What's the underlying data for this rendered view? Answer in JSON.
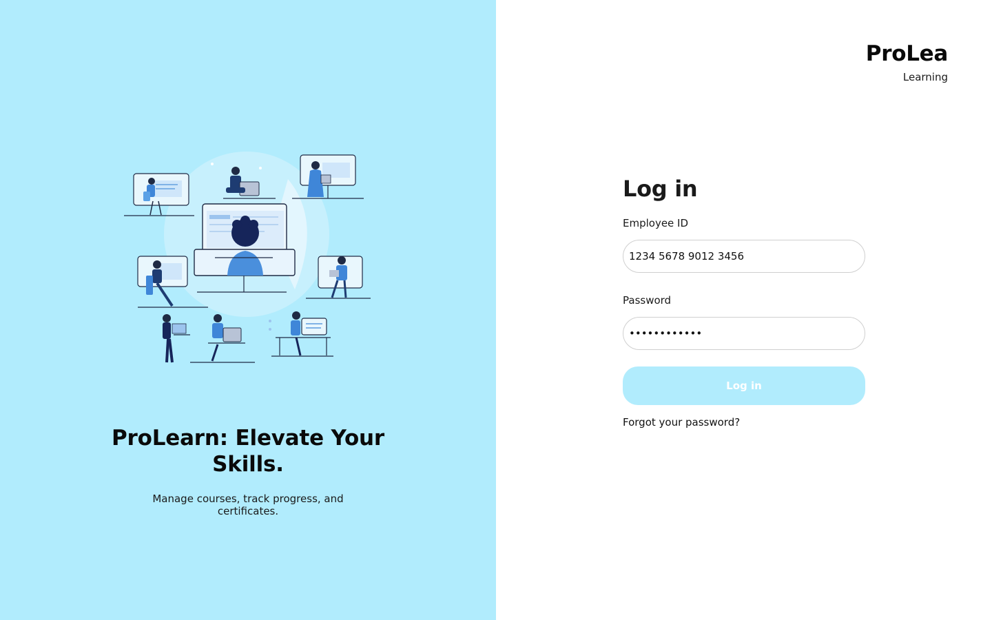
{
  "hero": {
    "title": "ProLearn: Elevate Your Skills.",
    "subtitle": "Manage courses, track progress, and certificates.",
    "background_color": "#b1ecfd"
  },
  "brand": {
    "name": "ProLea",
    "tagline": "Learning"
  },
  "login": {
    "title": "Log in",
    "employee_id_label": "Employee ID",
    "employee_id_value": "1234 5678 9012 3456",
    "password_label": "Password",
    "password_value": "••••••••••••",
    "button_label": "Log in",
    "forgot_password": "Forgot your password?",
    "accent_color": "#b1ecfd"
  },
  "icons": [
    "remote-work-illustration"
  ]
}
